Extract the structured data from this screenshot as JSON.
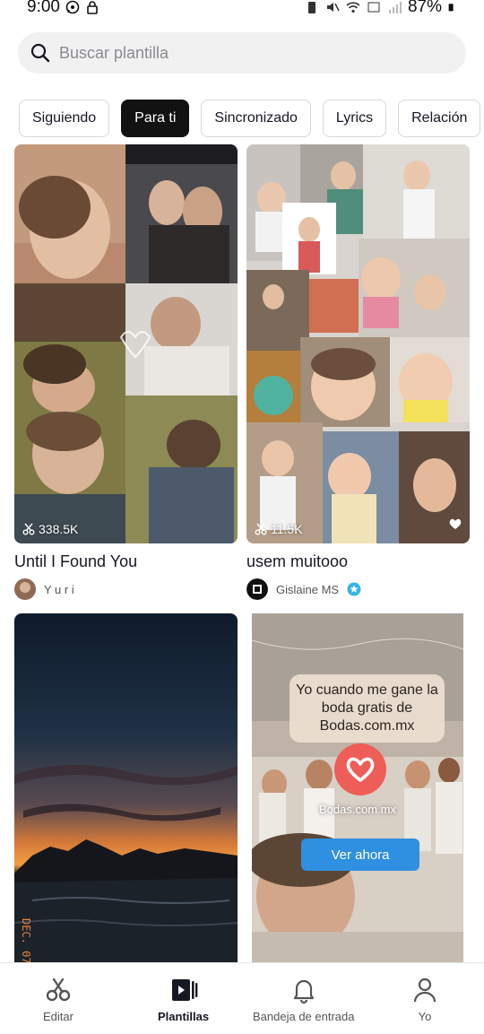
{
  "status_bar": {
    "time": "9:00",
    "battery": "87%"
  },
  "search": {
    "placeholder": "Buscar plantilla"
  },
  "tabs": [
    {
      "label": "Siguiendo",
      "active": false
    },
    {
      "label": "Para ti",
      "active": true
    },
    {
      "label": "Sincronizado",
      "active": false
    },
    {
      "label": "Lyrics",
      "active": false
    },
    {
      "label": "Relación",
      "active": false
    }
  ],
  "templates": [
    {
      "uses": "338.5K",
      "title": "Until I Found You",
      "author": "Y u r i"
    },
    {
      "uses": "11.5K",
      "title": "usem muitooo",
      "author": "Gislaine MS"
    }
  ],
  "photo_caption": "DEC. 07",
  "ad": {
    "headline": "Yo cuando me gane la boda gratis de Bodas.com.mx",
    "brand": "Bodas.com.mx",
    "cta": "Ver ahora"
  },
  "bottom_nav": [
    {
      "label": "Editar",
      "icon": "scissors-icon",
      "active": false
    },
    {
      "label": "Plantillas",
      "icon": "templates-icon",
      "active": true
    },
    {
      "label": "Bandeja de entrada",
      "icon": "bell-icon",
      "active": false
    },
    {
      "label": "Yo",
      "icon": "profile-icon",
      "active": false
    }
  ],
  "colors": {
    "accent_chip": "#121212",
    "cta_blue": "#2f8fe0",
    "ad_logo": "#ee5d57",
    "verified": "#33b5e5"
  }
}
